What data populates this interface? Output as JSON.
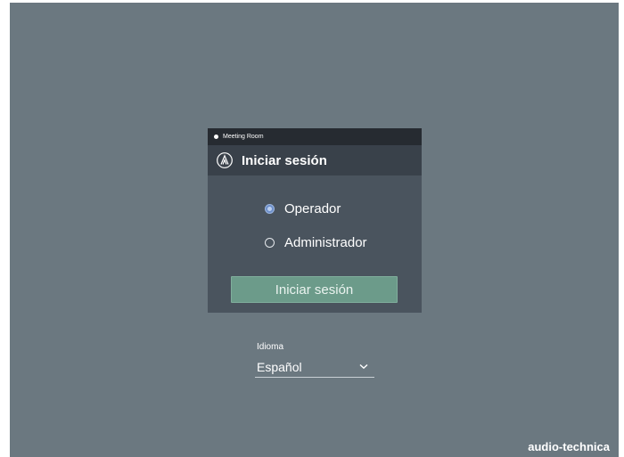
{
  "device": {
    "name": "Meeting Room"
  },
  "login": {
    "title": "Iniciar sesión",
    "roles": [
      {
        "label": "Operador",
        "selected": true
      },
      {
        "label": "Administrador",
        "selected": false
      }
    ],
    "submit_label": "Iniciar sesión"
  },
  "language": {
    "label": "Idioma",
    "value": "Español"
  },
  "brand": {
    "text": "audio-technica"
  },
  "icons": {
    "header": "audio-technica-logo-icon",
    "select": "chevron-down-icon"
  },
  "colors": {
    "background": "#6b7880",
    "button": "#6c9b8a",
    "selected_radio": "#6d8fc9"
  }
}
